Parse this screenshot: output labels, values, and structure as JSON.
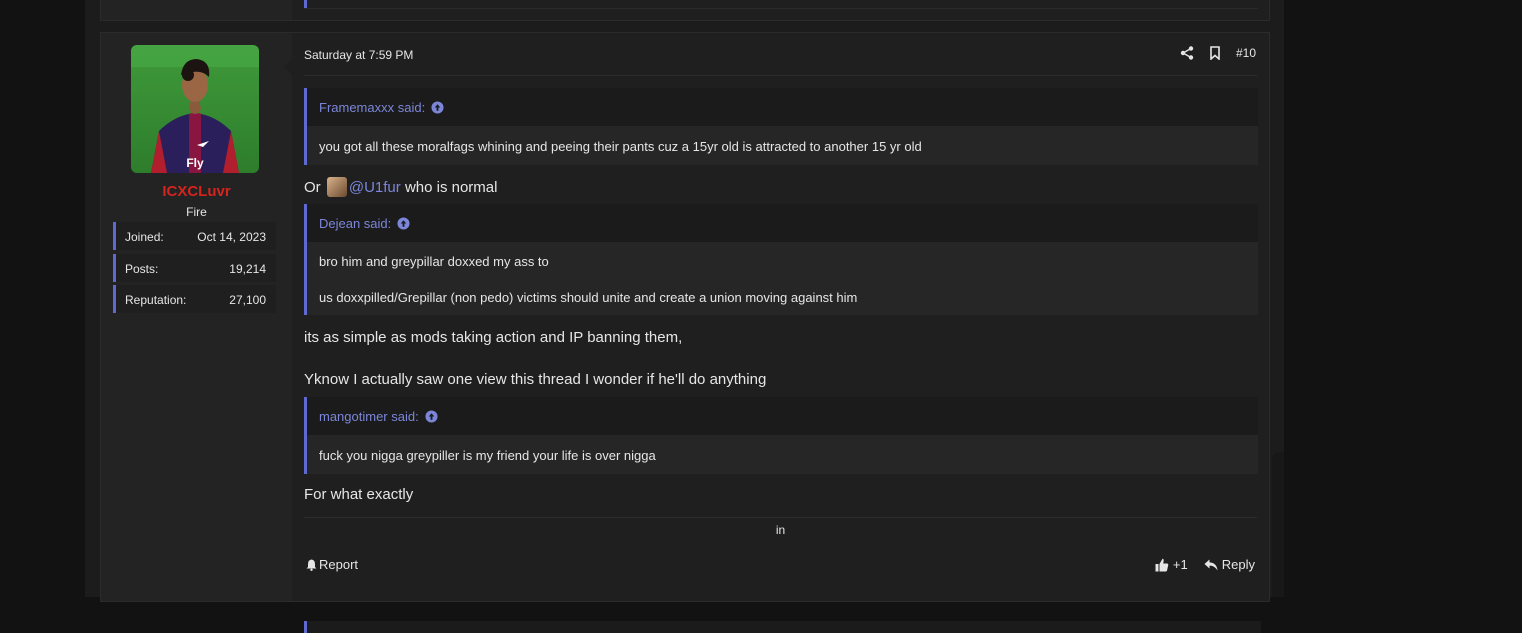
{
  "post": {
    "date": "Saturday at 7:59 PM",
    "post_number": "#10",
    "user": {
      "name": "ICXCLuvr",
      "title": "Fire",
      "stats": [
        {
          "label": "Joined:",
          "value": "Oct 14, 2023"
        },
        {
          "label": "Posts:",
          "value": "19,214"
        },
        {
          "label": "Reputation:",
          "value": "27,100"
        }
      ]
    },
    "quote1": {
      "author": "Framemaxxx said:",
      "lines": [
        "you got all these moralfags whining and peeing their pants cuz a 15yr old is attracted to another 15 yr old"
      ]
    },
    "line1": {
      "prefix": "Or",
      "mention": "@U1fur",
      "suffix": "who is normal"
    },
    "quote2": {
      "author": "Dejean said:",
      "lines": [
        "bro him and greypillar doxxed my ass to",
        "us doxxpilled/Grepillar (non pedo) victims should unite and create a union moving against him"
      ]
    },
    "para1": "its as simple as mods taking action and IP banning them,",
    "para2": "Yknow I actually saw one view this thread I wonder if he'll do anything",
    "quote3": {
      "author": "mangotimer said:",
      "lines": [
        "fuck you nigga greypiller is my friend your life is over nigga"
      ]
    },
    "para3": "For what exactly",
    "signature": "in",
    "footer": {
      "report": "Report",
      "like_count": "+1",
      "reply": "Reply"
    }
  },
  "colors": {
    "accent": "#5e6ad2",
    "link": "#7b86d9",
    "username": "#d5231e",
    "background": "#121212",
    "post_bg": "#1f1f1f"
  },
  "icons": [
    "share-icon",
    "bookmark-icon",
    "arrow-up-circle-icon",
    "bell-icon",
    "thumbs-up-icon",
    "reply-icon"
  ]
}
